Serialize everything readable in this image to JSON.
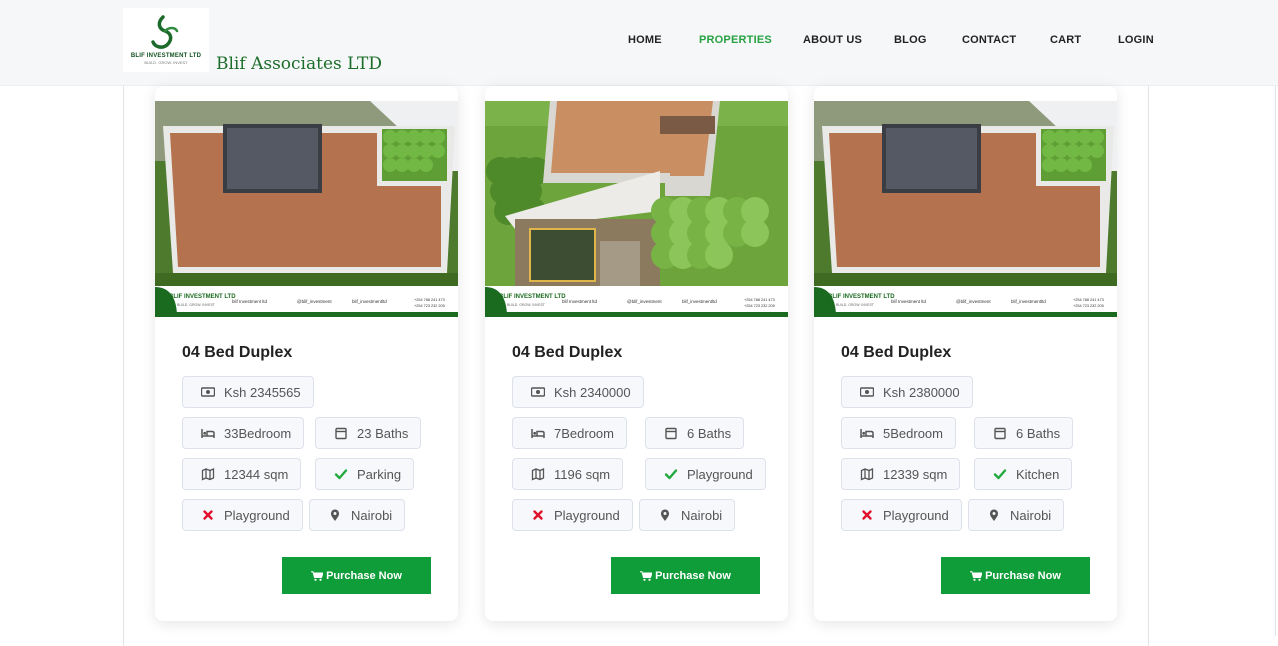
{
  "header": {
    "logo_text": "BLIF INVESTMENT LTD",
    "logo_sub": "BUILD. GROW. INVEST",
    "brand": "Blif Associates LTD",
    "nav": [
      "HOME",
      "PROPERTIES",
      "ABOUT US",
      "BLOG",
      "CONTACT",
      "CART",
      "LOGIN"
    ],
    "active_nav": "PROPERTIES"
  },
  "listings": [
    {
      "image": "roof-deck-view",
      "title": "04 Bed Duplex",
      "price": "Ksh 2345565",
      "bedrooms": "33Bedroom",
      "baths": "23 Baths",
      "area": "12344 sqm",
      "feature_yes": "Parking",
      "feature_no": "Playground",
      "location": "Nairobi",
      "button": "Purchase Now"
    },
    {
      "image": "front-aerial-view",
      "title": "04 Bed Duplex",
      "price": "Ksh 2340000",
      "bedrooms": "7Bedroom",
      "baths": "6 Baths",
      "area": "1196 sqm",
      "feature_yes": "Playground",
      "feature_no": "Playground",
      "location": "Nairobi",
      "button": "Purchase Now"
    },
    {
      "image": "roof-deck-view",
      "title": "04 Bed Duplex",
      "price": "Ksh 2380000",
      "bedrooms": "5Bedroom",
      "baths": "6 Baths",
      "area": "12339 sqm",
      "feature_yes": "Kitchen",
      "feature_no": "Playground",
      "location": "Nairobi",
      "button": "Purchase Now"
    }
  ],
  "banner": {
    "company": "BLIF INVESTMENT LTD",
    "tagline": "BUILD. GROW. INVEST",
    "facebook": "blif Investment ltd",
    "twitter": "@blif_investment",
    "instagram": "blif_investmentltd",
    "phones": "+254 788 241 473 / +254 723 232 205"
  },
  "colors": {
    "accent": "#0f9d3a",
    "nav_active": "#27a243",
    "brand": "#1c6d2a",
    "yes": "#22a93f",
    "no": "#e0112b"
  }
}
